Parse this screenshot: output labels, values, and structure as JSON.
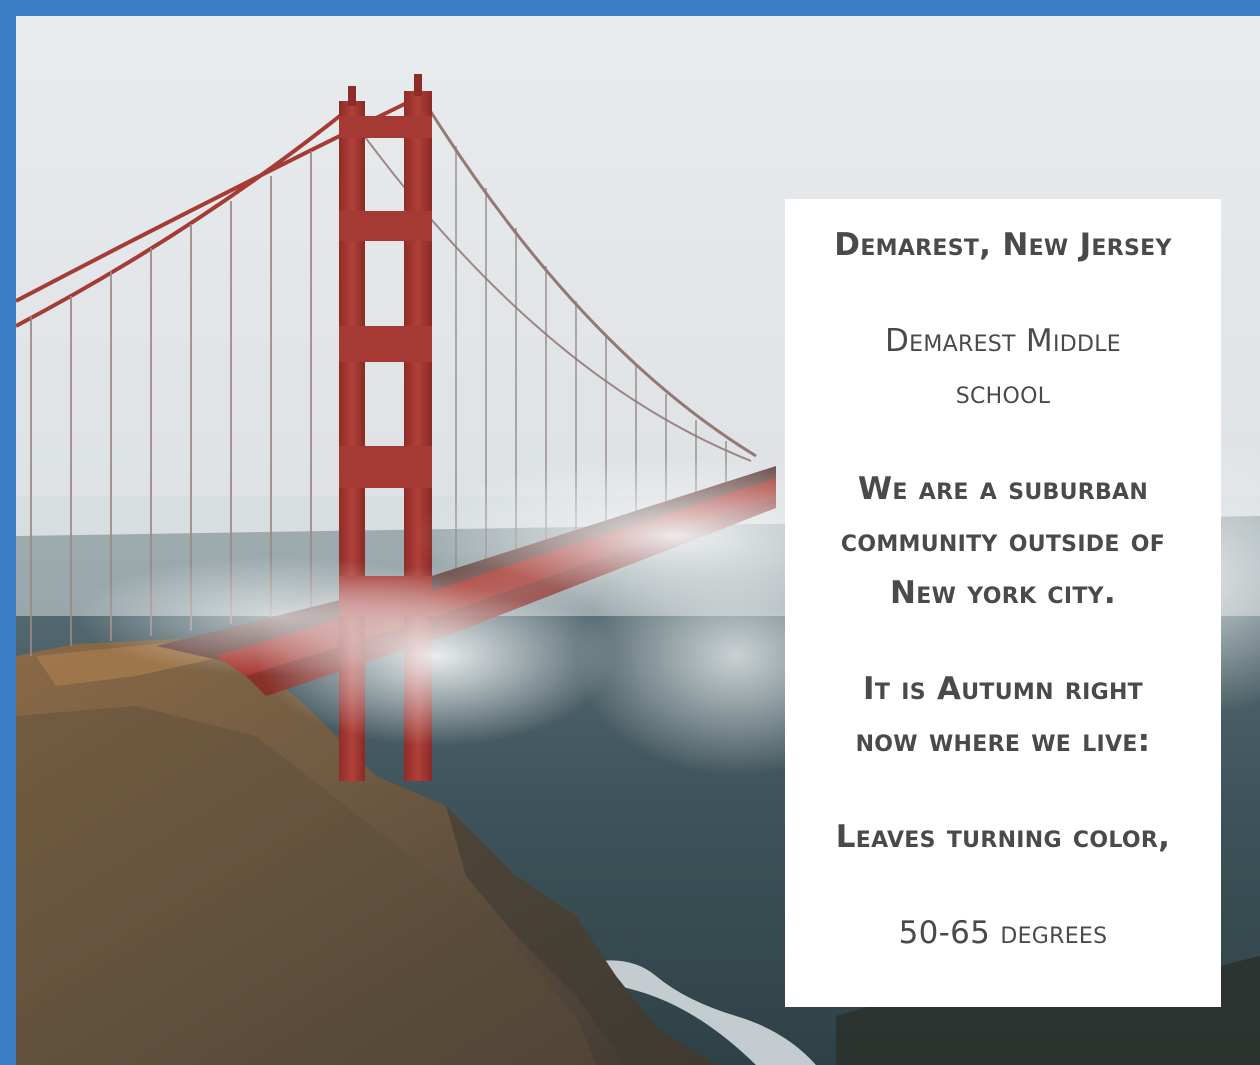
{
  "colors": {
    "border": "#3a7ec4",
    "card_background": "#ffffff",
    "text": "#4a4a4a",
    "bridge": "#a8352f",
    "water": "#3c5258",
    "cliff": "#6e5a40",
    "sky": "#e3e6e8"
  },
  "photo": {
    "subject": "red suspension bridge in fog above rocky cliff and sea"
  },
  "card": {
    "location": "Demarest, New Jersey",
    "school_line1": "Demarest Middle",
    "school_line2": "school",
    "community_line1": "We are a suburban",
    "community_line2": "community outside of",
    "community_line3": "New york city.",
    "season_line1": "It is Autumn right",
    "season_line2": "now where we live:",
    "leaves": "Leaves turning color,",
    "temperature": "50-65 degrees"
  }
}
